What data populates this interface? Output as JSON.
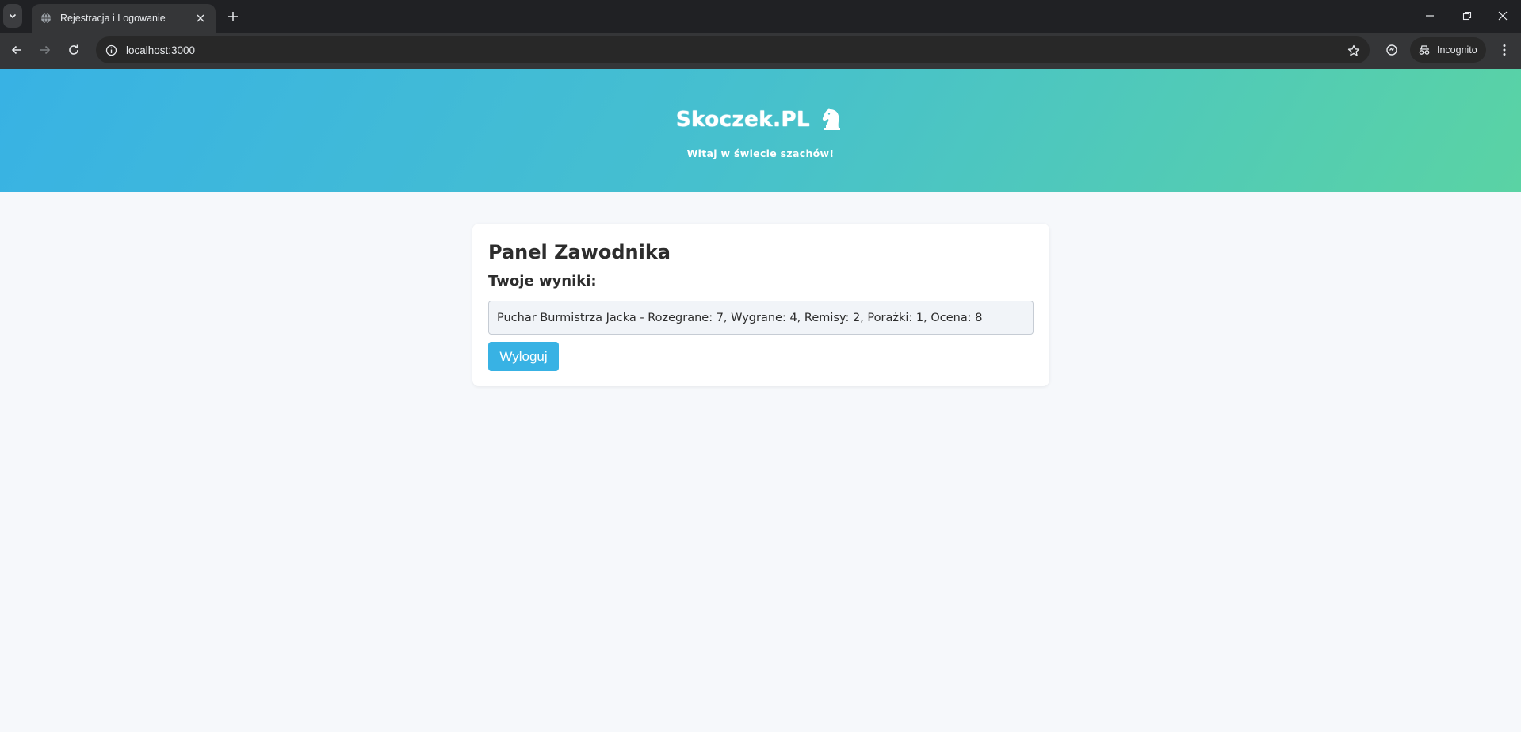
{
  "browser": {
    "tab_title": "Rejestracja i Logowanie",
    "url": "localhost:3000",
    "incognito_label": "Incognito"
  },
  "header": {
    "brand": "Skoczek.PL",
    "tagline": "Witaj w świecie szachów!",
    "gradient_start": "#38b2e4",
    "gradient_end": "#5ad3a4"
  },
  "panel": {
    "title": "Panel Zawodnika",
    "subtitle": "Twoje wyniki:",
    "results": [
      "Puchar Burmistrza Jacka - Rozegrane: 7, Wygrane: 4, Remisy: 2, Porażki: 1, Ocena: 8"
    ],
    "logout_label": "Wyloguj",
    "accent": "#38b2e4"
  },
  "icons": {
    "tab_search": "chevron-down-icon",
    "favicon": "globe-icon",
    "close": "close-icon",
    "new_tab": "plus-icon",
    "back": "back-arrow-icon",
    "forward": "forward-arrow-icon",
    "reload": "reload-icon",
    "site_info": "info-icon",
    "bookmark": "star-icon",
    "extension": "extension-icon",
    "incognito": "incognito-icon",
    "menu": "kebab-menu-icon",
    "brand": "chess-knight-icon"
  }
}
